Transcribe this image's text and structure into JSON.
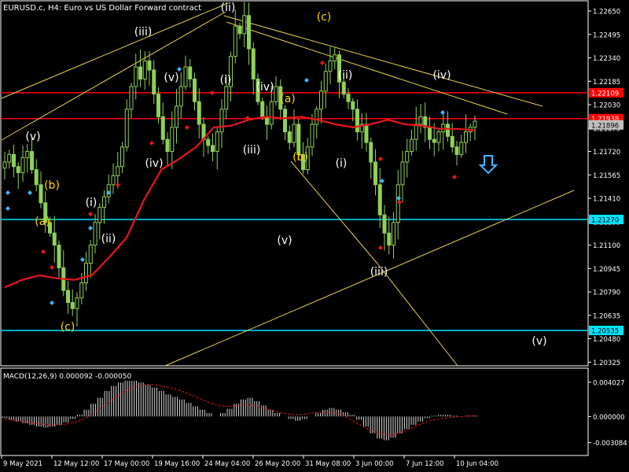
{
  "window": {
    "title": "EURUSD.c, H4:  Euro vs US Dollar Forward contract"
  },
  "chart_data": {
    "type": "candlestick",
    "symbol": "EURUSD.c",
    "timeframe": "H4",
    "description": "Euro vs US Dollar Forward contract",
    "ylim": [
      1.20327,
      1.22697
    ],
    "y_ticks": [
      "1.22650",
      "1.22495",
      "1.22340",
      "1.22185",
      "1.22030",
      "1.21875",
      "1.21720",
      "1.21565",
      "1.21410",
      "1.21255",
      "1.21100",
      "1.20945",
      "1.20790",
      "1.20635",
      "1.20480",
      "1.20325"
    ],
    "x_ticks": [
      "9 May 2021",
      "12 May 12:00",
      "17 May 00:00",
      "19 May 16:00",
      "24 May 04:00",
      "26 May 20:00",
      "31 May 08:00",
      "3 Jun 00:00",
      "7 Jun 12:00",
      "10 Jun 04:00"
    ],
    "close_series": [
      1.2165,
      1.217,
      1.2162,
      1.2158,
      1.2168,
      1.2172,
      1.216,
      1.215,
      1.2138,
      1.2125,
      1.2118,
      1.211,
      1.2095,
      1.208,
      1.2072,
      1.2068,
      1.2075,
      1.2085,
      1.2098,
      1.211,
      1.2125,
      1.2135,
      1.2142,
      1.215,
      1.2156,
      1.2162,
      1.2175,
      1.22,
      1.2215,
      1.2228,
      1.222,
      1.2232,
      1.2226,
      1.221,
      1.2195,
      1.218,
      1.2172,
      1.2188,
      1.2202,
      1.2215,
      1.2228,
      1.222,
      1.2205,
      1.219,
      1.218,
      1.2176,
      1.2172,
      1.2185,
      1.22,
      1.2215,
      1.2235,
      1.2255,
      1.225,
      1.2262,
      1.224,
      1.222,
      1.2205,
      1.2195,
      1.219,
      1.2205,
      1.2215,
      1.22,
      1.2185,
      1.2178,
      1.219,
      1.217,
      1.216,
      1.2175,
      1.219,
      1.22,
      1.2212,
      1.2225,
      1.2232,
      1.2236,
      1.2218,
      1.221,
      1.2205,
      1.22,
      1.2185,
      1.219,
      1.2178,
      1.2165,
      1.215,
      1.213,
      1.2118,
      1.211,
      1.2125,
      1.215,
      1.2165,
      1.2172,
      1.218,
      1.219,
      1.2195,
      1.2188,
      1.218,
      1.2178,
      1.2185,
      1.219,
      1.2182,
      1.2175,
      1.217,
      1.2178,
      1.2185,
      1.2188,
      1.2192
    ],
    "series": [
      {
        "values": [
          1.2082,
          1.2087,
          1.209,
          1.2088,
          1.2087,
          1.209,
          1.2102,
          1.2115,
          1.214,
          1.216,
          1.2167,
          1.2175,
          1.2188,
          1.2189,
          1.2193,
          1.2195,
          1.2194,
          1.2195,
          1.2193,
          1.219,
          1.2188,
          1.219,
          1.2193,
          1.219,
          1.2189,
          1.2187,
          1.2187,
          1.2186
        ]
      }
    ],
    "horizontal_levels": [
      {
        "label": "1.22109",
        "value": 1.22109,
        "color": "#ff0000"
      },
      {
        "label": "1.21938",
        "value": 1.21938,
        "color": "#ff0000"
      },
      {
        "label": "1.21270",
        "value": 1.2127,
        "color": "#00e5ff"
      },
      {
        "label": "1.20535",
        "value": 1.20535,
        "color": "#00e5ff"
      }
    ],
    "current_price": {
      "label": "1.21896",
      "value": 1.21896
    },
    "wave_labels": [
      {
        "text": "(v)",
        "color": "#ffffff"
      },
      {
        "text": "(b)",
        "color": "#ffd700"
      },
      {
        "text": "(a)",
        "color": "#ffd700"
      },
      {
        "text": "(c)",
        "color": "#ffd700"
      },
      {
        "text": "(i)",
        "color": "#ffffff"
      },
      {
        "text": "(ii)",
        "color": "#ffffff"
      },
      {
        "text": "(iii)",
        "color": "#ffffff"
      },
      {
        "text": "(iv)",
        "color": "#ffffff"
      },
      {
        "text": "(v)",
        "color": "#ffffff"
      },
      {
        "text": "(ii)",
        "color": "#ffffff"
      },
      {
        "text": "(i)",
        "color": "#ffffff"
      },
      {
        "text": "(iv)",
        "color": "#ffffff"
      },
      {
        "text": "(a)",
        "color": "#ffd700"
      },
      {
        "text": "(iii)",
        "color": "#ffffff"
      },
      {
        "text": "(b)",
        "color": "#ffd700"
      },
      {
        "text": "(v)",
        "color": "#ffffff"
      },
      {
        "text": "(c)",
        "color": "#ffd700"
      },
      {
        "text": "(ii)",
        "color": "#ffffff"
      },
      {
        "text": "(i)",
        "color": "#ffffff"
      },
      {
        "text": "(iii)",
        "color": "#ffffff"
      },
      {
        "text": "(iv)",
        "color": "#ffffff"
      },
      {
        "text": "(v)",
        "color": "#ffffff"
      }
    ],
    "macd": {
      "label": "MACD(12,26,9) 0.000092 -0.000050",
      "ylim": [
        -0.0045,
        0.0055
      ],
      "y_ticks": [
        "0.004027",
        "0.000000",
        "-0.003084"
      ],
      "histogram": [
        -0.0002,
        -0.0004,
        -0.0006,
        -0.0008,
        -0.001,
        -0.0012,
        -0.0013,
        -0.0012,
        -0.001,
        -0.0007,
        -0.0003,
        0.0002,
        0.0008,
        0.0015,
        0.0022,
        0.003,
        0.0036,
        0.004,
        0.0042,
        0.0042,
        0.004,
        0.0037,
        0.0034,
        0.003,
        0.0026,
        0.0023,
        0.002,
        0.0016,
        0.0012,
        0.0008,
        0.0004,
        0.0,
        0.0004,
        0.0009,
        0.0015,
        0.002,
        0.0022,
        0.0018,
        0.0013,
        0.0008,
        0.0004,
        0.0,
        -0.0003,
        -0.0005,
        -0.0003,
        0.0,
        0.0004,
        0.0008,
        0.001,
        0.0008,
        0.0005,
        0.0002,
        -0.0004,
        -0.0012,
        -0.002,
        -0.0026,
        -0.0028,
        -0.0025,
        -0.002,
        -0.0015,
        -0.001,
        -0.0006,
        -0.0002,
        0.0001,
        0.0002,
        0.0002,
        0.0001,
        0.0,
        0.0001,
        0.0001
      ],
      "signal": [
        -0.0003,
        -0.0005,
        -0.0007,
        -0.0009,
        -0.001,
        -0.0009,
        -0.0006,
        0.0,
        0.001,
        0.002,
        0.003,
        0.0036,
        0.0038,
        0.0036,
        0.0033,
        0.0028,
        0.0022,
        0.0016,
        0.0012,
        0.0012,
        0.0014,
        0.0012,
        0.0008,
        0.0004,
        0.0002,
        0.0003,
        0.0005,
        0.0005,
        0.0002,
        -0.0006,
        -0.0014,
        -0.002,
        -0.0022,
        -0.0018,
        -0.0012,
        -0.0006,
        -0.0003,
        -0.0001,
        0.0,
        0.0001
      ]
    }
  }
}
